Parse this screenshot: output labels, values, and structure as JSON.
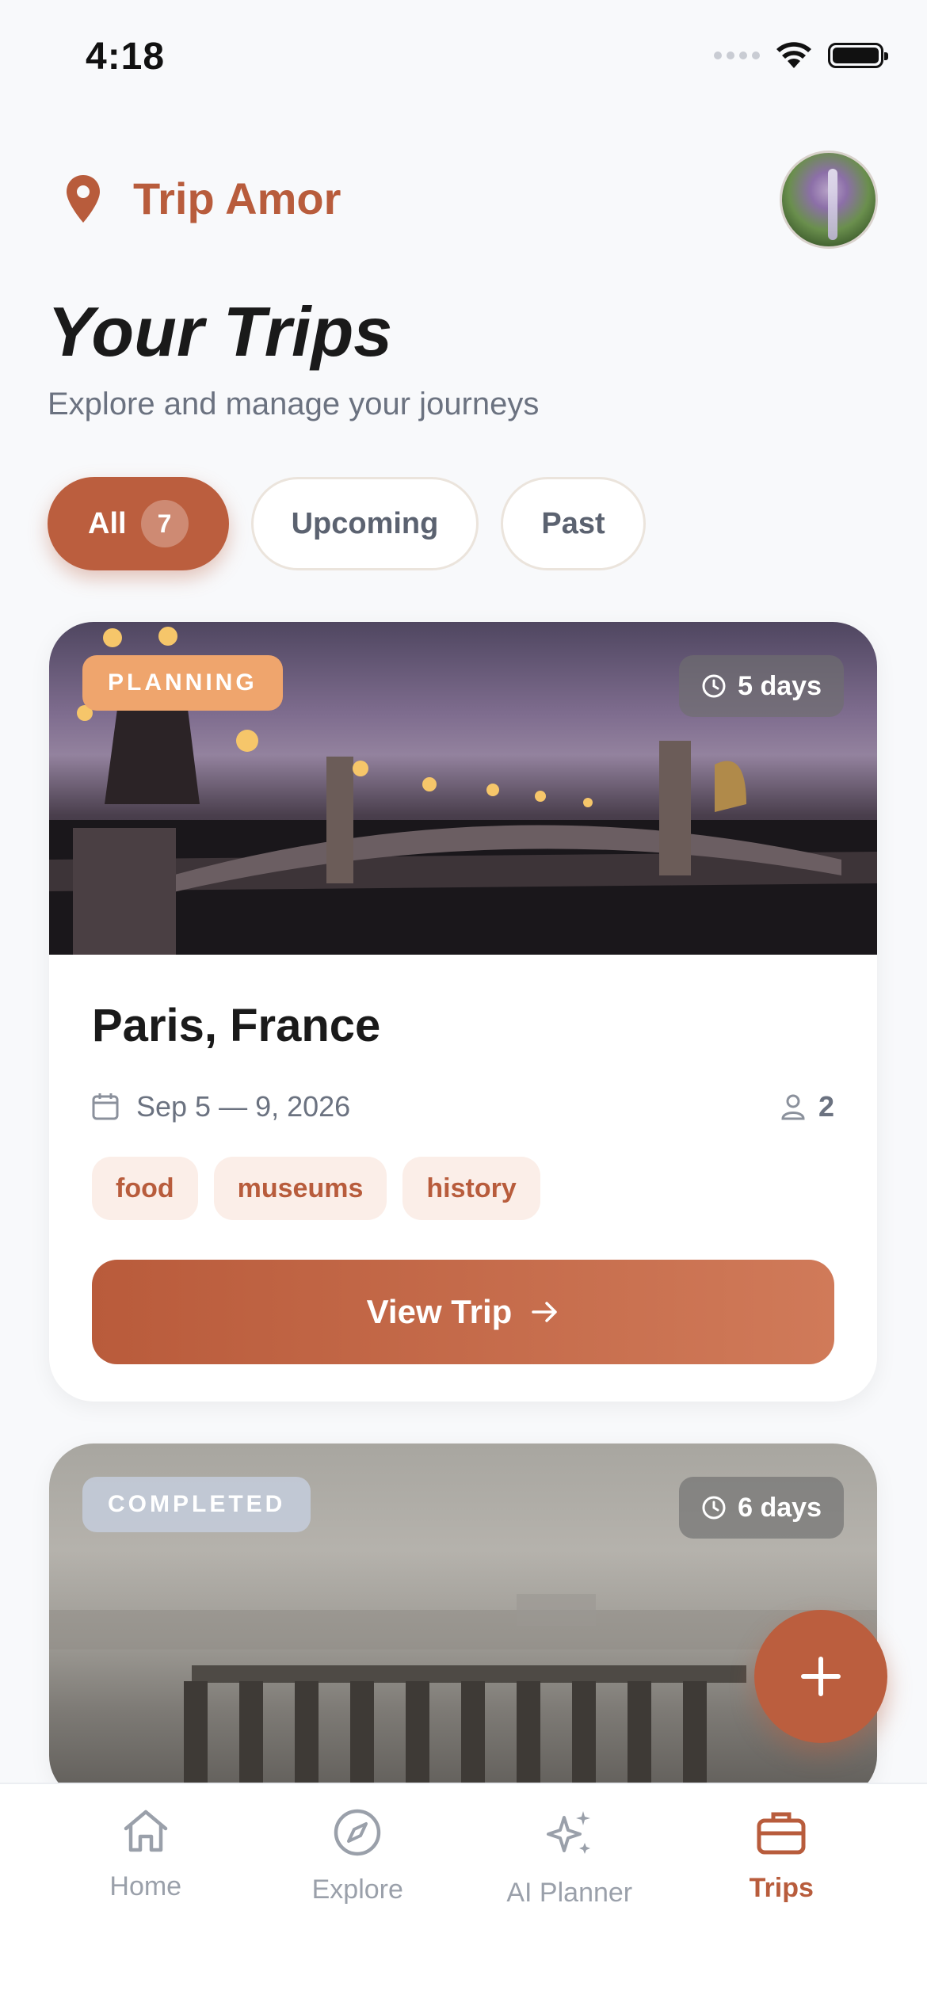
{
  "status_bar": {
    "time": "4:18"
  },
  "header": {
    "brand_name": "Trip Amor",
    "title": "Your Trips",
    "subtitle": "Explore and manage your journeys"
  },
  "filters": {
    "all": {
      "label": "All",
      "count": "7"
    },
    "upcoming": {
      "label": "Upcoming"
    },
    "past": {
      "label": "Past"
    }
  },
  "trips": [
    {
      "status": "PLANNING",
      "duration": "5 days",
      "title": "Paris, France",
      "dates": "Sep 5 — 9, 2026",
      "travelers": "2",
      "tags": [
        "food",
        "museums",
        "history"
      ],
      "cta": "View Trip"
    },
    {
      "status": "COMPLETED",
      "duration": "6 days"
    }
  ],
  "nav": {
    "items": [
      {
        "label": "Home",
        "icon": "home-icon"
      },
      {
        "label": "Explore",
        "icon": "compass-icon"
      },
      {
        "label": "AI Planner",
        "icon": "sparkles-icon"
      },
      {
        "label": "Trips",
        "icon": "briefcase-icon"
      }
    ],
    "active": "Trips"
  },
  "colors": {
    "accent": "#bb5e3e",
    "planning_badge": "#efa56d",
    "completed_badge": "#c4ccdc",
    "tag_bg": "#fbeee8"
  }
}
